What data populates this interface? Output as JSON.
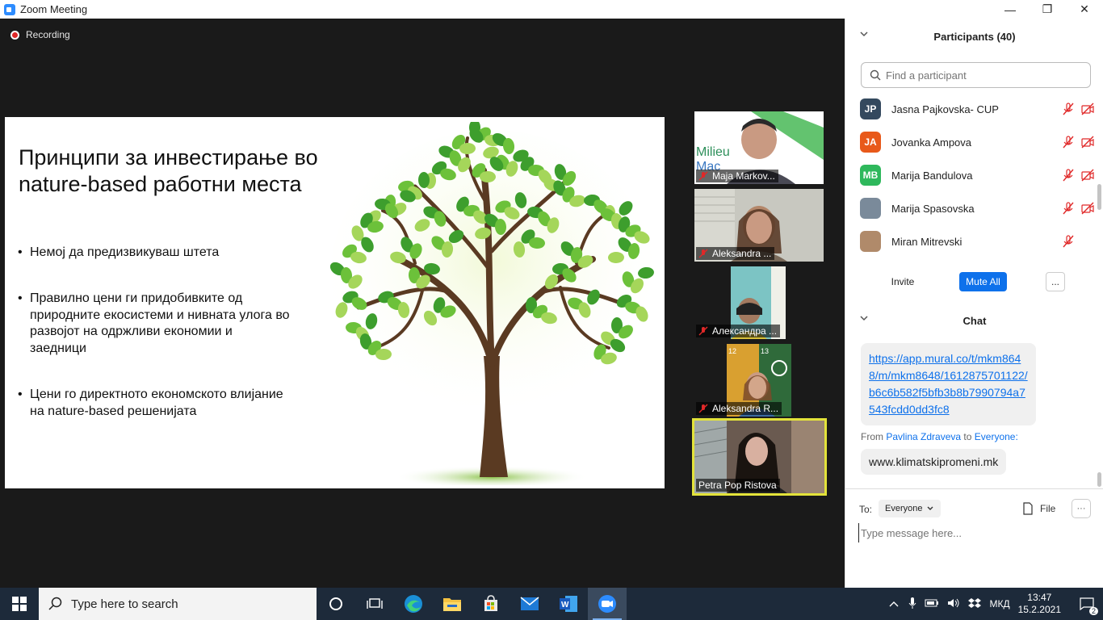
{
  "window": {
    "title": "Zoom Meeting",
    "minimize": "—",
    "maximize": "❐",
    "close": "✕"
  },
  "meeting": {
    "recording_label": "Recording"
  },
  "slide": {
    "title": "Принципи за инвестирање во nature-based работни места",
    "bullets": [
      "Немој да предизвикуваш штета",
      "Правилно цени ги придобивките од природните екосистеми и нивната улога во развојот на одржливи економии и заедници",
      "Цени го директното економското влијание на nature-based решенијата"
    ]
  },
  "videos": [
    {
      "name": "Maja Markov...",
      "muted": true,
      "bg_text": "Milieu Kontakt Mac"
    },
    {
      "name": "Aleksandra ...",
      "muted": true
    },
    {
      "name": "Александра ...",
      "muted": true
    },
    {
      "name": "Aleksandra R...",
      "muted": true,
      "bg_numbers": [
        "12",
        "13"
      ],
      "bg_text": "CLIMATE ACTION"
    },
    {
      "name": "Petra Pop Ristova",
      "muted": false,
      "active_speaker": true
    }
  ],
  "participants_panel": {
    "title": "Participants (40)",
    "search_placeholder": "Find a participant",
    "participants": [
      {
        "initials": "JP",
        "name": "Jasna Pajkovska- CUP",
        "color": "#34495e",
        "mic_muted": true,
        "video_off": true
      },
      {
        "initials": "JA",
        "name": "Jovanka Ampova",
        "color": "#e8591a",
        "mic_muted": true,
        "video_off": true
      },
      {
        "initials": "MB",
        "name": "Marija Bandulova",
        "color": "#2eb85c",
        "mic_muted": true,
        "video_off": true
      },
      {
        "initials": "",
        "name": "Marija Spasovska",
        "color": "#7a8a9a",
        "mic_muted": true,
        "video_off": true
      },
      {
        "initials": "",
        "name": "Miran Mitrevski",
        "color": "#b08a6a",
        "mic_muted": true,
        "video_off": false
      }
    ],
    "invite_label": "Invite",
    "mute_all_label": "Mute All",
    "more_label": "..."
  },
  "chat_panel": {
    "title": "Chat",
    "messages": [
      {
        "text": "https://app.mural.co/t/mkm8648/m/mkm8648/1612875701122/b6c6b582f5bfb3b8b7990794a7543fcdd0dd3fc8",
        "is_link": true
      },
      {
        "from_prefix": "From",
        "sender": "Pavlina Zdraveva",
        "to_word": "to",
        "recipient": "Everyone:",
        "text": "www.klimatskipromeni.mk"
      }
    ],
    "to_label": "To:",
    "to_value": "Everyone",
    "file_label": "File",
    "more_label": "···",
    "input_placeholder": "Type message here..."
  },
  "taskbar": {
    "search_placeholder": "Type here to search",
    "language": "МКД",
    "time": "13:47",
    "date": "15.2.2021",
    "notification_count": "2",
    "pinned_icons": [
      "task-view-icon",
      "cortana-icon",
      "edge-icon",
      "file-explorer-icon",
      "store-icon",
      "mail-icon",
      "word-icon",
      "zoom-icon"
    ]
  }
}
